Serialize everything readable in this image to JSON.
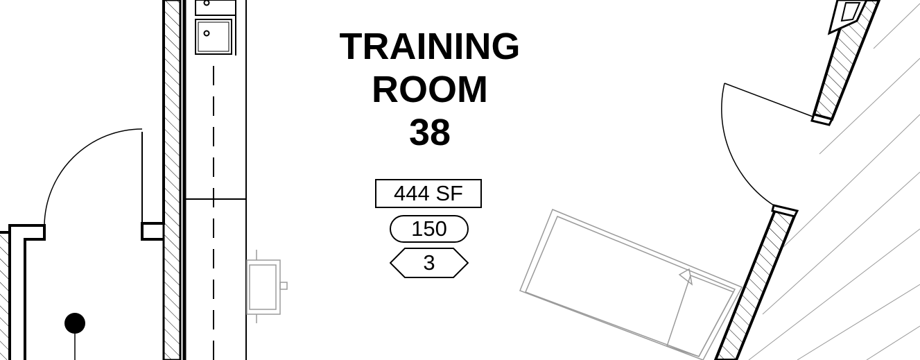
{
  "room": {
    "name_line1": "TRAINING",
    "name_line2": "ROOM",
    "number": "38"
  },
  "tags": {
    "area": "444 SF",
    "occupancy": "150",
    "level": "3"
  }
}
